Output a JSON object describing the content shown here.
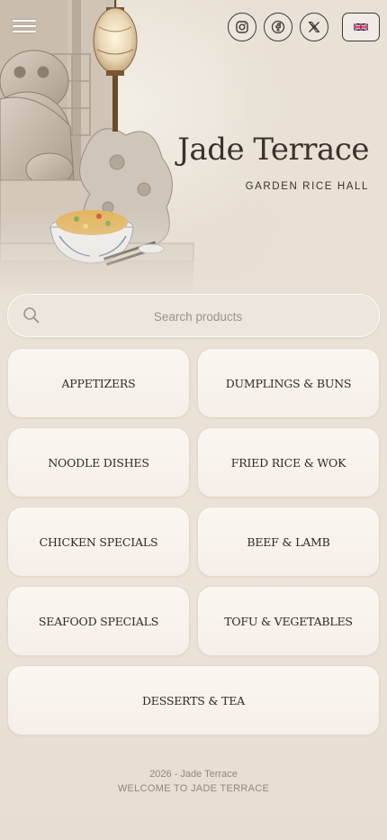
{
  "header": {
    "brand_title": "Jade Terrace",
    "brand_subtitle": "GARDEN RICE HALL",
    "menu_icon": "hamburger-menu-icon",
    "social": [
      "instagram-icon",
      "facebook-icon",
      "x-icon"
    ],
    "language_flag": "uk-flag-icon"
  },
  "search": {
    "placeholder": "Search products",
    "icon": "search-icon"
  },
  "categories": [
    "APPETIZERS",
    "DUMPLINGS & BUNS",
    "NOODLE DISHES",
    "FRIED RICE & WOK",
    "CHICKEN SPECIALS",
    "BEEF & LAMB",
    "SEAFOOD SPECIALS",
    "TOFU & VEGETABLES",
    "DESSERTS & TEA"
  ],
  "footer": {
    "copyright": "2026 - Jade Terrace",
    "welcome": "WELCOME TO JADE TERRACE"
  },
  "colors": {
    "background": "#e9e1d6",
    "card": "#f8f2ec",
    "text_dark": "#2f2a25",
    "footer_text": "#8f8882"
  }
}
